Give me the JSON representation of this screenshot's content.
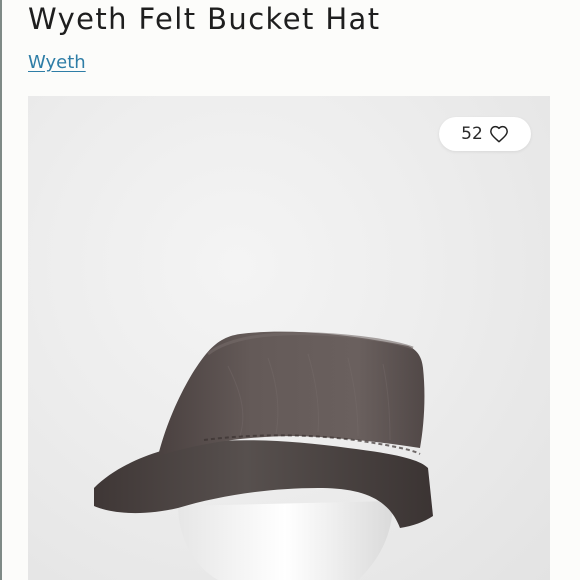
{
  "product": {
    "title": "Wyeth Felt Bucket Hat",
    "brand": "Wyeth"
  },
  "likes": {
    "count": "52",
    "icon": "heart-outline-icon"
  },
  "image": {
    "subject": "brown felt bucket hat on white mannequin head",
    "hat_color": "#5e5452",
    "background_color": "#ececec"
  },
  "colors": {
    "link": "#2e7da6",
    "title": "#1e1e1e"
  }
}
